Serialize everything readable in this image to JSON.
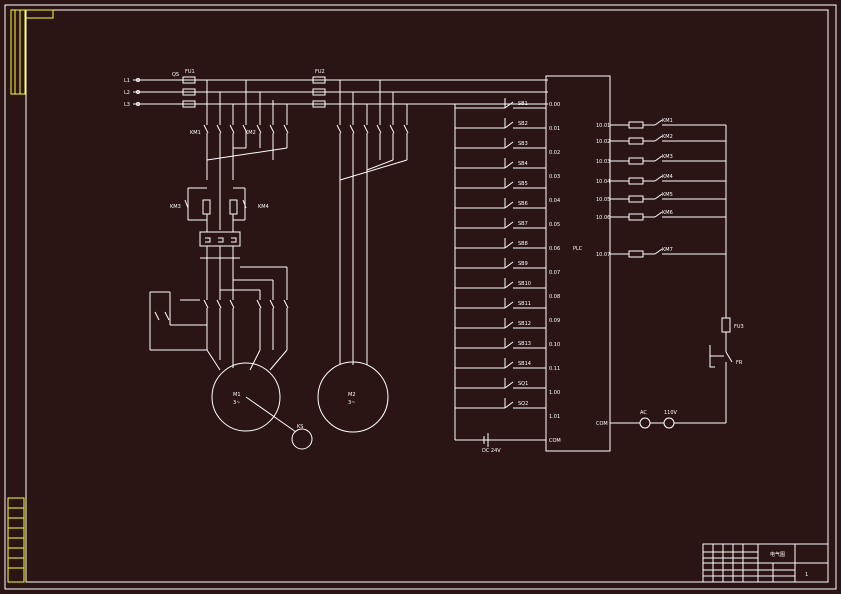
{
  "phase_lines": [
    "L1",
    "L2",
    "L3"
  ],
  "breakers": [
    "QS",
    "FU1",
    "FU2"
  ],
  "motor_main": {
    "name": "M1",
    "sub": "3~"
  },
  "motor_pump": {
    "name": "M2",
    "sub": "3~"
  },
  "tacho": "KS",
  "contactors": {
    "km1": "KM1",
    "km2": "KM2",
    "km3": "KM3",
    "km4": "KM4"
  },
  "plc": {
    "label": "PLC",
    "inputs": [
      "0.00",
      "0.01",
      "0.02",
      "0.03",
      "0.04",
      "0.05",
      "0.06",
      "0.07",
      "0.08",
      "0.09",
      "0.10",
      "0.11",
      "1.00",
      "1.01",
      "COM"
    ],
    "outputs": [
      "10.01",
      "10.02",
      "10.03",
      "10.04",
      "10.05",
      "10.06",
      "10.07"
    ],
    "com_out": "COM"
  },
  "input_switches": [
    "SB1",
    "SB2",
    "SB3",
    "SB4",
    "SB5",
    "SB6",
    "SB7",
    "SB8",
    "SB9",
    "SB10",
    "SB11",
    "SB12",
    "SB13",
    "SB14",
    "SQ1",
    "SQ2"
  ],
  "output_devices": [
    "KM1",
    "KM2",
    "KM3",
    "KM4",
    "KM5",
    "KM6",
    "KM7"
  ],
  "fuse_right": "FU3",
  "fr_label": "FR",
  "ac_label": "AC",
  "ac_v": "110V",
  "dc_label": "DC 24V",
  "title_block": {
    "name": "电气图",
    "sheet": "1"
  }
}
